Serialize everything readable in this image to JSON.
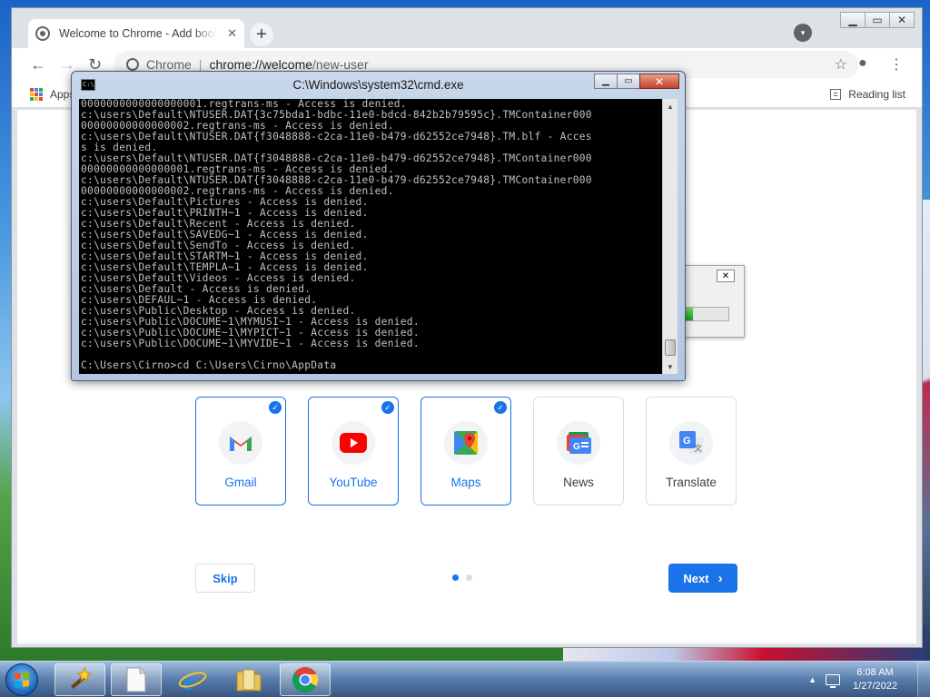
{
  "chrome": {
    "tab_title": "Welcome to Chrome - Add bookmarks",
    "tab_close": "✕",
    "new_tab": "+",
    "url_scheme": "Chrome",
    "url_host": "chrome://welcome",
    "url_path": "/new-user",
    "apps_label": "Apps",
    "reading_list": "Reading list"
  },
  "welcome": {
    "apps": [
      {
        "label": "Gmail",
        "selected": true
      },
      {
        "label": "YouTube",
        "selected": true
      },
      {
        "label": "Maps",
        "selected": true
      },
      {
        "label": "News",
        "selected": false
      },
      {
        "label": "Translate",
        "selected": false
      }
    ],
    "skip_label": "Skip",
    "next_label": "Next",
    "page_dots": 2,
    "current_dot": 1
  },
  "cmd": {
    "title": "C:\\Windows\\system32\\cmd.exe",
    "icon_text": "C:\\",
    "lines": [
      "0000000000000000001.regtrans-ms - Access is denied.",
      "c:\\users\\Default\\NTUSER.DAT{3c75bda1-bdbc-11e0-bdcd-842b2b79595c}.TMContainer000",
      "00000000000000002.regtrans-ms - Access is denied.",
      "c:\\users\\Default\\NTUSER.DAT{f3048888-c2ca-11e0-b479-d62552ce7948}.TM.blf - Acces",
      "s is denied.",
      "c:\\users\\Default\\NTUSER.DAT{f3048888-c2ca-11e0-b479-d62552ce7948}.TMContainer000",
      "00000000000000001.regtrans-ms - Access is denied.",
      "c:\\users\\Default\\NTUSER.DAT{f3048888-c2ca-11e0-b479-d62552ce7948}.TMContainer000",
      "00000000000000002.regtrans-ms - Access is denied.",
      "c:\\users\\Default\\Pictures - Access is denied.",
      "c:\\users\\Default\\PRINTH~1 - Access is denied.",
      "c:\\users\\Default\\Recent - Access is denied.",
      "c:\\users\\Default\\SAVEDG~1 - Access is denied.",
      "c:\\users\\Default\\SendTo - Access is denied.",
      "c:\\users\\Default\\STARTM~1 - Access is denied.",
      "c:\\users\\Default\\TEMPLA~1 - Access is denied.",
      "c:\\users\\Default\\Videos - Access is denied.",
      "c:\\users\\Default - Access is denied.",
      "c:\\users\\DEFAUL~1 - Access is denied.",
      "c:\\users\\Public\\Desktop - Access is denied.",
      "c:\\users\\Public\\DOCUME~1\\MYMUSI~1 - Access is denied.",
      "c:\\users\\Public\\DOCUME~1\\MYPICT~1 - Access is denied.",
      "c:\\users\\Public\\DOCUME~1\\MYVIDE~1 - Access is denied.",
      "",
      "C:\\Users\\Cirno>cd C:\\Users\\Cirno\\AppData"
    ]
  },
  "progress_dialog": {
    "close": "✕",
    "progress_fraction": 0.3
  },
  "taskbar": {
    "items": [
      {
        "name": "wand-app",
        "icon": "magic-wand-icon",
        "active": true
      },
      {
        "name": "notepad",
        "icon": "document-icon",
        "active": true
      },
      {
        "name": "internet-explorer",
        "icon": "ie-icon",
        "active": false
      },
      {
        "name": "explorer",
        "icon": "folder-icon",
        "active": false
      },
      {
        "name": "chrome",
        "icon": "chrome-icon",
        "active": true
      }
    ],
    "time": "6:08 AM",
    "date": "1/27/2022"
  },
  "colors": {
    "accent": "#1a73e8",
    "console_bg": "#000000",
    "console_fg": "#c0c0c0"
  }
}
